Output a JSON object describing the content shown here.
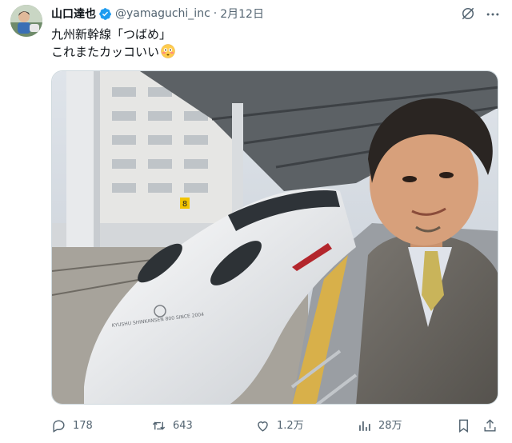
{
  "post": {
    "author_name": "山口達也",
    "handle": "@yamaguchi_inc",
    "separator": "·",
    "date": "2月12日",
    "text_line1": "九州新幹線「つばめ」",
    "text_line2": "これまたカッコいい",
    "emoji": "flushed-face-emoji"
  },
  "media": {
    "train_car_number": "8",
    "train_livery_text": "KYUSHU SHINKANSEN 800 SINCE 2004"
  },
  "actions": {
    "replies": "178",
    "reposts": "643",
    "likes": "1.2万",
    "views": "28万"
  },
  "colors": {
    "verified": "#1d9bf0",
    "secondary_text": "#536471",
    "primary_text": "#0f1419"
  }
}
